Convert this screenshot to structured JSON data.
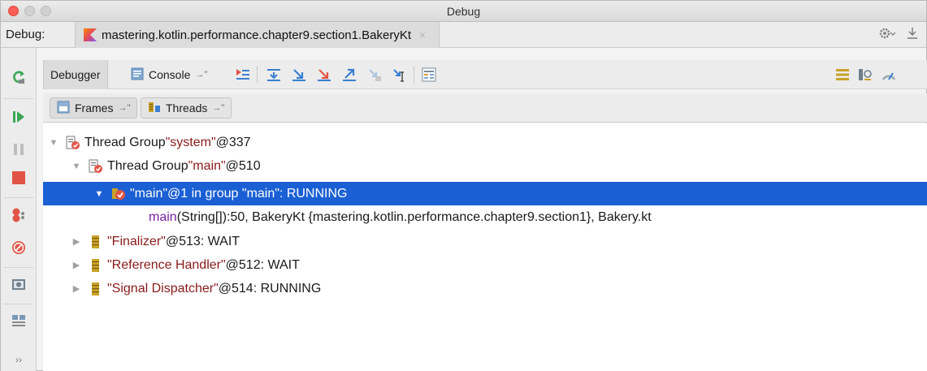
{
  "window": {
    "title": "Debug"
  },
  "header": {
    "label": "Debug:",
    "session_tab": "mastering.kotlin.performance.chapter9.section1.BakeryKt",
    "close_glyph": "×"
  },
  "toolbar": {
    "debugger_tab": "Debugger",
    "console_tab": "Console",
    "pin_glyph": "→\""
  },
  "view_tabs": {
    "frames": "Frames",
    "threads": "Threads",
    "pin_glyph": "→\""
  },
  "tree": {
    "system_group": {
      "prefix": "Thread Group ",
      "name": "\"system\"",
      "suffix": "@337"
    },
    "main_group": {
      "prefix": "Thread Group ",
      "name": "\"main\"",
      "suffix": "@510"
    },
    "main_thread": {
      "text": "\"main\"@1 in group \"main\": RUNNING"
    },
    "frame": {
      "method": "main",
      "rest": "(String[]):50, BakeryKt {mastering.kotlin.performance.chapter9.section1}, Bakery.kt"
    },
    "threads": [
      {
        "name": "\"Finalizer\"",
        "suffix": "@513: WAIT"
      },
      {
        "name": "\"Reference Handler\"",
        "suffix": "@512: WAIT"
      },
      {
        "name": "\"Signal Dispatcher\"",
        "suffix": "@514: RUNNING"
      }
    ]
  },
  "left_toolbar": {
    "more_glyph": "››"
  },
  "colors": {
    "selection": "#1b5fd4",
    "string": "#8a1a1a",
    "method": "#7a1fa2"
  }
}
